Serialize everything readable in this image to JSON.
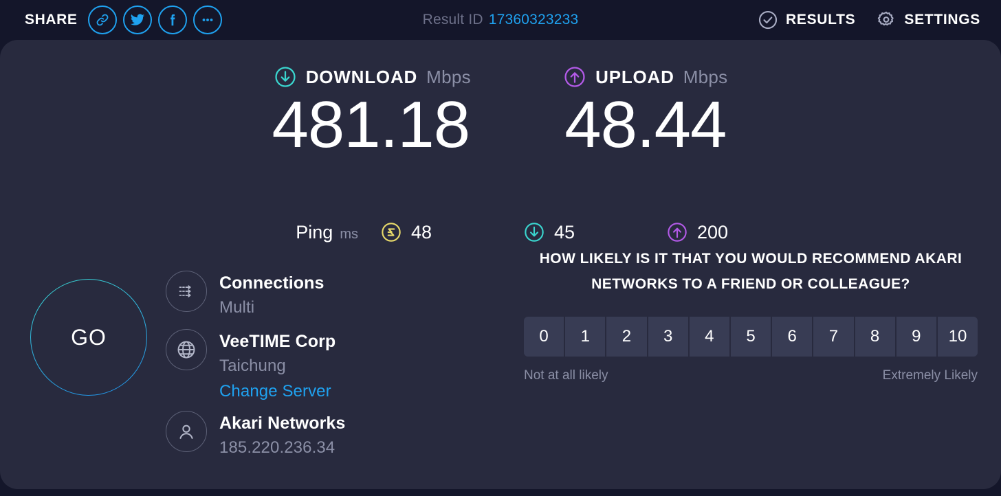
{
  "header": {
    "share_label": "SHARE",
    "share_buttons": [
      {
        "name": "copy-link",
        "icon": "link-icon"
      },
      {
        "name": "twitter",
        "icon": "twitter-icon"
      },
      {
        "name": "facebook",
        "icon": "facebook-icon"
      },
      {
        "name": "more",
        "icon": "ellipsis-icon"
      }
    ],
    "result_id_label": "Result ID",
    "result_id_value": "17360323233",
    "results_label": "RESULTS",
    "settings_label": "SETTINGS",
    "accent_blue": "#1fa2f0"
  },
  "speeds": {
    "download": {
      "name": "DOWNLOAD",
      "unit": "Mbps",
      "value": "481.18",
      "color": "#3ad6cf",
      "icon": "download-arrow-icon"
    },
    "upload": {
      "name": "UPLOAD",
      "unit": "Mbps",
      "value": "48.44",
      "color": "#b35ae8",
      "icon": "upload-arrow-icon"
    }
  },
  "ping": {
    "label": "Ping",
    "unit": "ms",
    "stats": [
      {
        "name": "idle-latency",
        "icon": "latency-icon",
        "value": "48",
        "color": "#e8da6a"
      },
      {
        "name": "download-latency",
        "icon": "download-arrow-icon",
        "value": "45",
        "color": "#3ad6cf"
      },
      {
        "name": "upload-latency",
        "icon": "upload-arrow-icon",
        "value": "200",
        "color": "#b35ae8"
      }
    ]
  },
  "go_button": {
    "label": "GO"
  },
  "connection_info": [
    {
      "icon": "connections-icon",
      "title": "Connections",
      "sub": "Multi",
      "link": null
    },
    {
      "icon": "globe-icon",
      "title": "VeeTIME Corp",
      "sub": "Taichung",
      "link": "Change Server"
    },
    {
      "icon": "person-icon",
      "title": "Akari Networks",
      "sub": "185.220.236.34",
      "link": null
    }
  ],
  "nps": {
    "question": "HOW LIKELY IS IT THAT YOU WOULD RECOMMEND AKARI NETWORKS TO A FRIEND OR COLLEAGUE?",
    "options": [
      "0",
      "1",
      "2",
      "3",
      "4",
      "5",
      "6",
      "7",
      "8",
      "9",
      "10"
    ],
    "low_label": "Not at all likely",
    "high_label": "Extremely Likely"
  }
}
